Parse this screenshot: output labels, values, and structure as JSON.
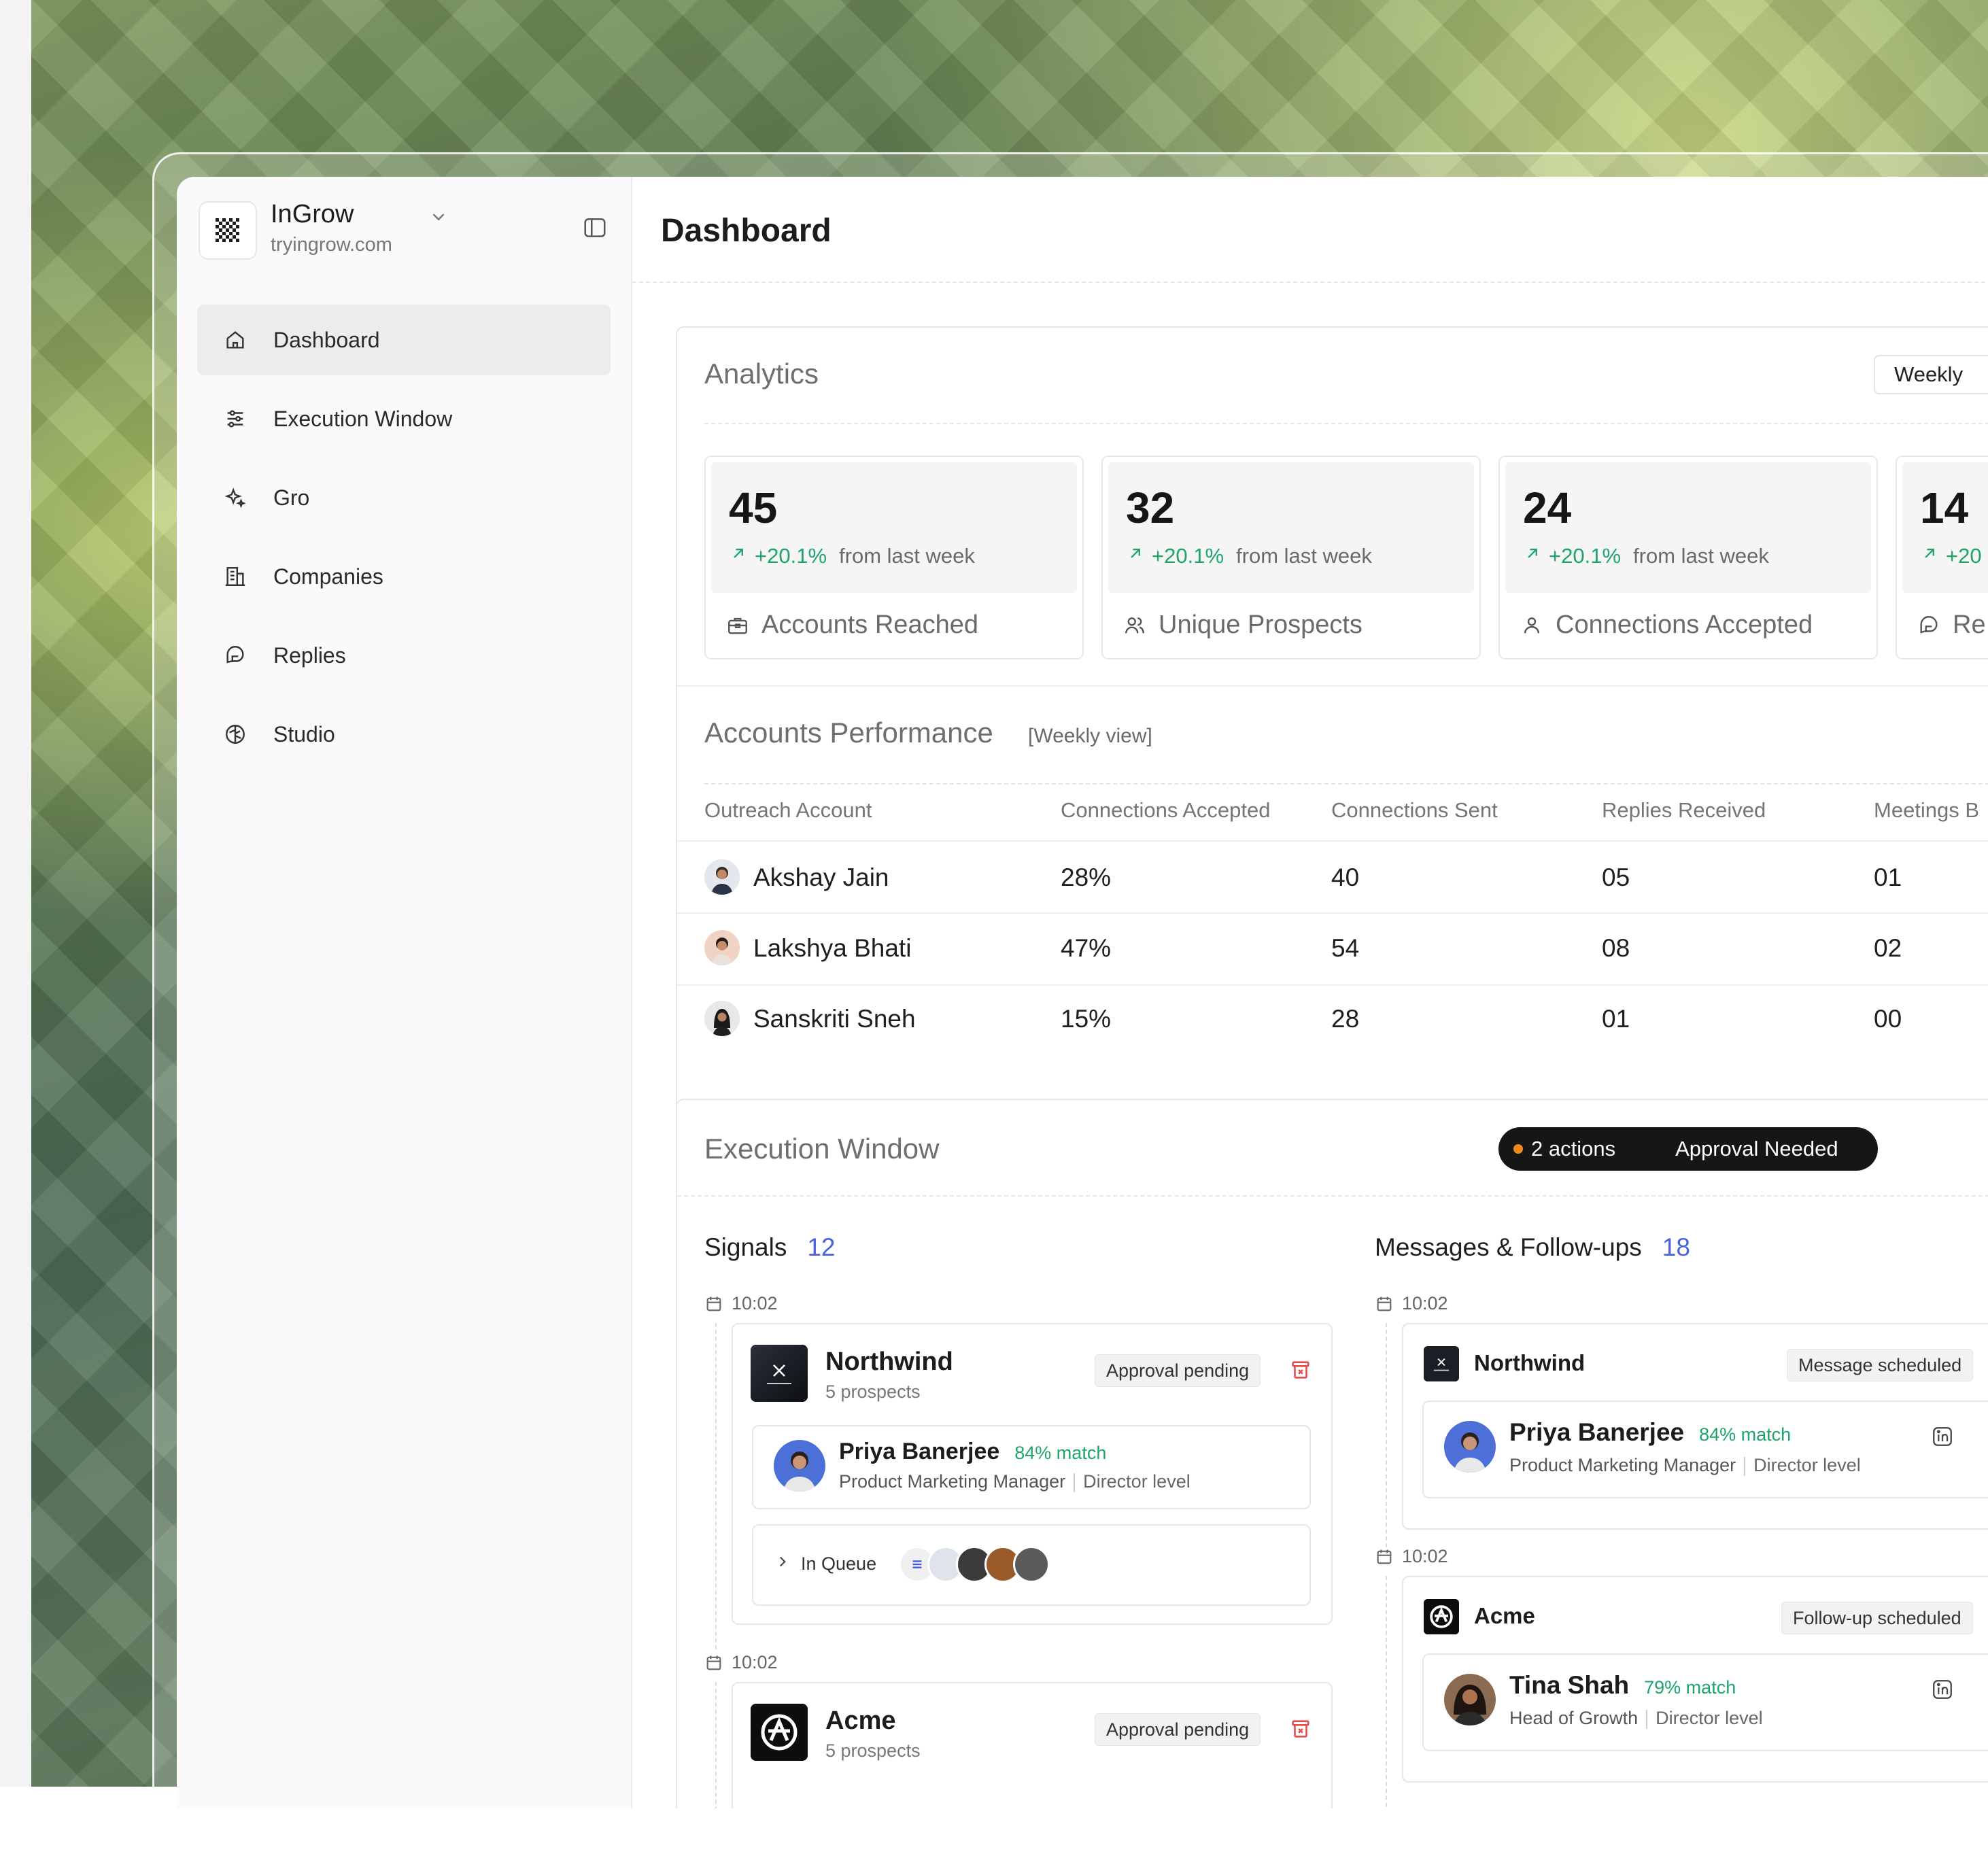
{
  "brand": {
    "name": "InGrow",
    "url": "tryingrow.com"
  },
  "nav": [
    {
      "label": "Dashboard",
      "icon": "home-icon",
      "active": true
    },
    {
      "label": "Execution Window",
      "icon": "sliders-icon",
      "active": false
    },
    {
      "label": "Gro",
      "icon": "sparkles-icon",
      "active": false
    },
    {
      "label": "Companies",
      "icon": "building-icon",
      "active": false
    },
    {
      "label": "Replies",
      "icon": "message-icon",
      "active": false
    },
    {
      "label": "Studio",
      "icon": "brain-icon",
      "active": false
    }
  ],
  "page": {
    "title": "Dashboard"
  },
  "analytics": {
    "title": "Analytics",
    "period": "Weekly",
    "stats": [
      {
        "value": "45",
        "change": "+20.1%",
        "period_text": "from last week",
        "label": "Accounts Reached",
        "icon": "briefcase-icon"
      },
      {
        "value": "32",
        "change": "+20.1%",
        "period_text": "from last week",
        "label": "Unique Prospects",
        "icon": "users-icon"
      },
      {
        "value": "24",
        "change": "+20.1%",
        "period_text": "from last week",
        "label": "Connections Accepted",
        "icon": "user-icon"
      },
      {
        "value": "14",
        "change": "+20",
        "period_text": "",
        "label": "Re",
        "icon": "message-icon"
      }
    ]
  },
  "performance": {
    "title": "Accounts Performance",
    "subtitle": "[Weekly view]",
    "columns": [
      "Outreach Account",
      "Connections Accepted",
      "Connections Sent",
      "Replies Received",
      "Meetings B"
    ],
    "rows": [
      {
        "name": "Akshay Jain",
        "accepted": "28%",
        "sent": "40",
        "replies": "05",
        "meetings": "01"
      },
      {
        "name": "Lakshya Bhati",
        "accepted": "47%",
        "sent": "54",
        "replies": "08",
        "meetings": "02"
      },
      {
        "name": "Sanskriti Sneh",
        "accepted": "15%",
        "sent": "28",
        "replies": "01",
        "meetings": "00"
      }
    ]
  },
  "execution": {
    "title": "Execution Window",
    "actions": "2 actions",
    "approval": "Approval Needed",
    "signals": {
      "title": "Signals",
      "count": "12",
      "items": [
        {
          "time": "10:02",
          "company": "Northwind",
          "prospects": "5 prospects",
          "status": "Approval pending",
          "person": {
            "name": "Priya Banerjee",
            "match": "84% match",
            "role": "Product Marketing Manager",
            "level": "Director level"
          },
          "queue": "In Queue"
        },
        {
          "time": "10:02",
          "company": "Acme",
          "prospects": "5 prospects",
          "status": "Approval pending"
        }
      ]
    },
    "messages": {
      "title": "Messages & Follow-ups",
      "count": "18",
      "items": [
        {
          "time": "10:02",
          "company": "Northwind",
          "status": "Message scheduled",
          "person": {
            "name": "Priya Banerjee",
            "match": "84% match",
            "role": "Product Marketing Manager",
            "level": "Director level"
          }
        },
        {
          "time": "10:02",
          "company": "Acme",
          "status": "Follow-up scheduled",
          "person": {
            "name": "Tina Shah",
            "match": "79% match",
            "role": "Head of Growth",
            "level": "Director level"
          }
        }
      ]
    }
  },
  "colors": {
    "accent_green": "#1ea66a",
    "accent_blue": "#4a63d8",
    "dark": "#161616",
    "danger": "#e5484d",
    "pending_dot": "#f08a1a"
  }
}
